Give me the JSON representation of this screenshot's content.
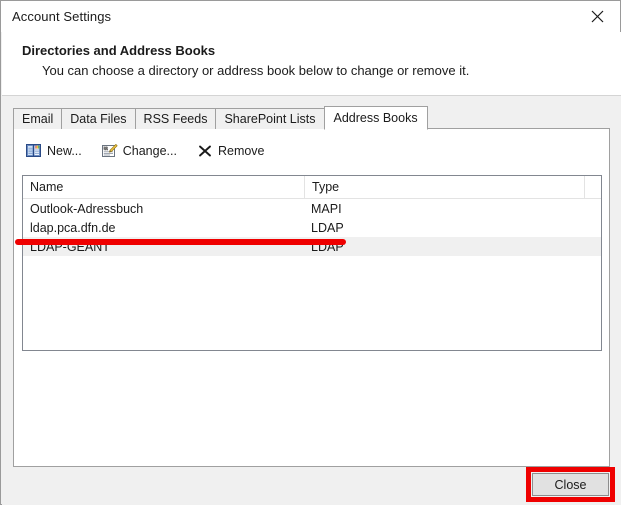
{
  "window": {
    "title": "Account Settings",
    "close_icon": "close-x-icon"
  },
  "banner": {
    "heading": "Directories and Address Books",
    "description": "You can choose a directory or address book below to change or remove it."
  },
  "tabs": [
    {
      "label": "Email",
      "active": false
    },
    {
      "label": "Data Files",
      "active": false
    },
    {
      "label": "RSS Feeds",
      "active": false
    },
    {
      "label": "SharePoint Lists",
      "active": false
    },
    {
      "label": "Address Books",
      "active": true
    }
  ],
  "toolbar": {
    "buttons": [
      {
        "label": "New...",
        "icon": "address-book-icon"
      },
      {
        "label": "Change...",
        "icon": "properties-pencil-icon"
      },
      {
        "label": "Remove",
        "icon": "x-mark-icon"
      }
    ]
  },
  "list": {
    "columns": [
      {
        "label": "Name"
      },
      {
        "label": "Type"
      },
      {
        "label": ""
      }
    ],
    "rows": [
      {
        "name": "Outlook-Adressbuch",
        "type": "MAPI",
        "selected": false
      },
      {
        "name": "ldap.pca.dfn.de",
        "type": "LDAP",
        "selected": false
      },
      {
        "name": "LDAP-GEANT",
        "type": "LDAP",
        "selected": true
      }
    ]
  },
  "footer": {
    "close_label": "Close"
  },
  "annotations": {
    "underline_color": "#ef0000",
    "highlight_box_color": "#ef0000"
  }
}
